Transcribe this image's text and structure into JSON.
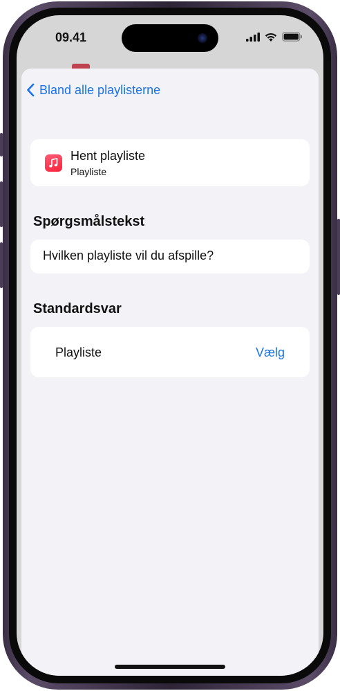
{
  "status_bar": {
    "time": "09.41"
  },
  "navigation": {
    "back_label": "Bland alle playlisterne"
  },
  "action": {
    "title": "Hent playliste",
    "subtitle": "Playliste",
    "icon": "music-note-icon",
    "icon_color": "#fa233b"
  },
  "prompt_section": {
    "title": "Spørgsmålstekst",
    "text": "Hvilken playliste vil du afspille?"
  },
  "default_section": {
    "title": "Standardsvar",
    "parameter_label": "Playliste",
    "choose_label": "Vælg"
  },
  "colors": {
    "accent": "#1a73e8",
    "sheet_background": "#f2f2f7",
    "card_background": "#ffffff"
  }
}
